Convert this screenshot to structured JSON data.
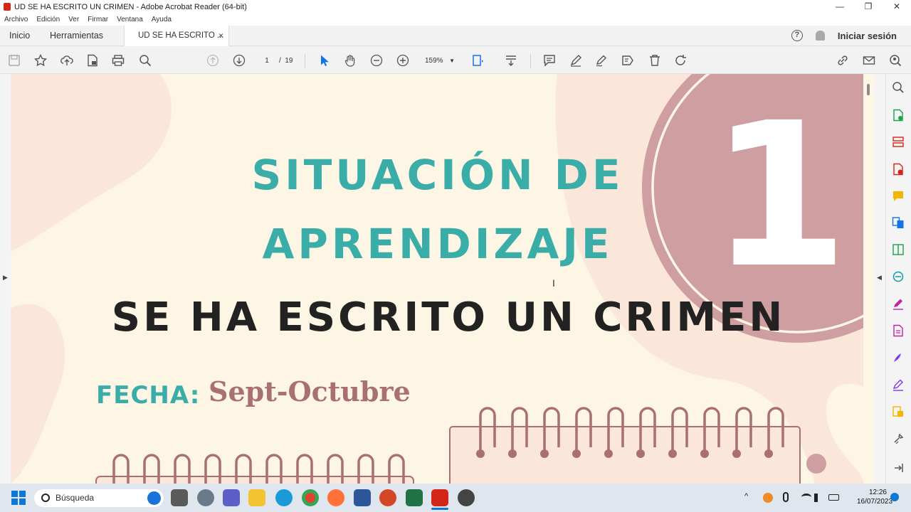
{
  "window": {
    "title": "UD SE HA ESCRITO UN CRIMEN - Adobe Acrobat Reader (64-bit)",
    "controls": [
      "—",
      "❐",
      "✕"
    ]
  },
  "menu": [
    "Archivo",
    "Edición",
    "Ver",
    "Firmar",
    "Ventana",
    "Ayuda"
  ],
  "tabs": {
    "home": "Inicio",
    "tools": "Herramientas",
    "document": "UD SE HA ESCRITO ...",
    "close": "×"
  },
  "header_right": {
    "help": "?",
    "signin": "Iniciar sesión"
  },
  "toolbar": {
    "current_page": "1",
    "page_separator": "/",
    "total_pages": "19",
    "zoom": "159%"
  },
  "document": {
    "title_line1": "SITUACIÓN DE",
    "title_line2": "APRENDIZAJE",
    "number": "1",
    "headline": "SE HA ESCRITO UN CRIMEN",
    "date_label": "FECHA:",
    "date_value": "Sept-Octubre"
  },
  "taskbar": {
    "search_placeholder": "Búsqueda",
    "time": "12:26",
    "date": "16/07/2023"
  },
  "colors": {
    "teal": "#3aada8",
    "rose": "#cf9ea0",
    "cream": "#fdf6e4",
    "brown": "#a87070"
  }
}
